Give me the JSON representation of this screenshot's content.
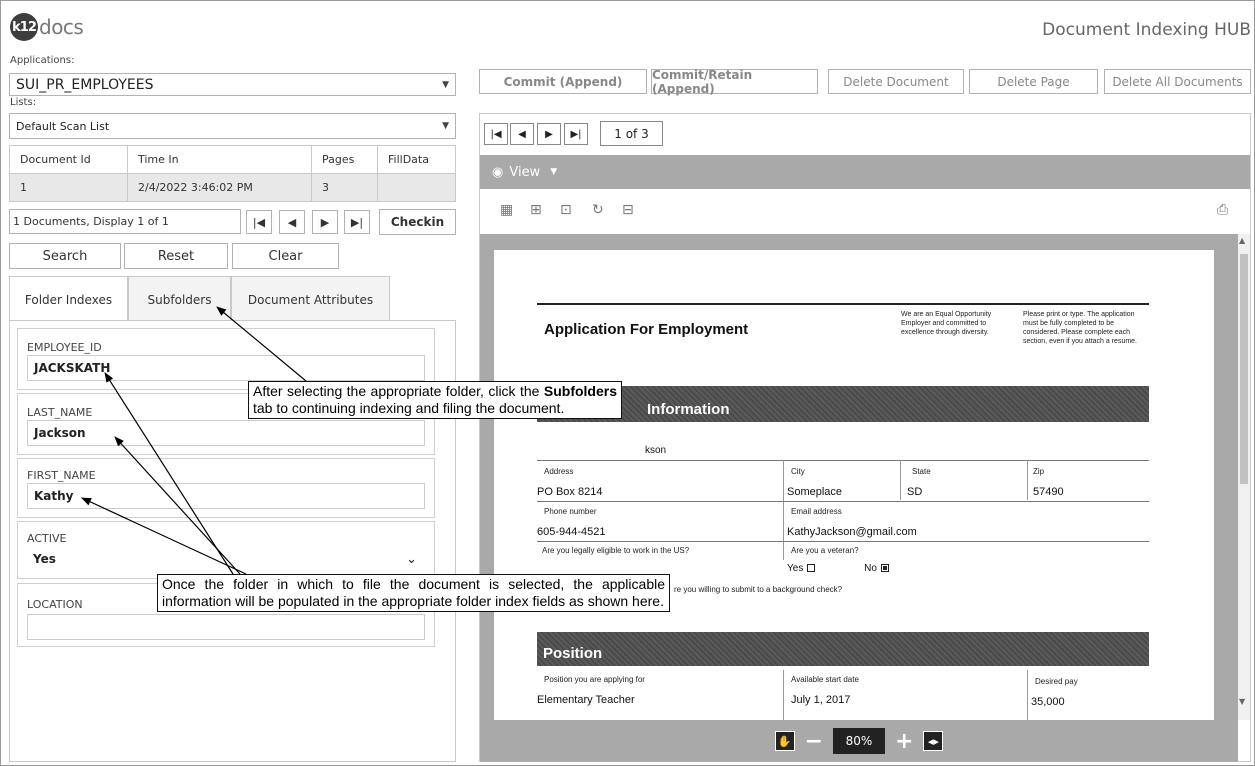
{
  "header": {
    "logo_badge": "k12",
    "logo_text": "docs",
    "app_title": "Document Indexing HUB"
  },
  "left": {
    "applications_label": "Applications:",
    "application_value": "SUI_PR_EMPLOYEES",
    "lists_label": "Lists:",
    "list_value": "Default Scan List",
    "grid": {
      "columns": [
        "Document Id",
        "Time In",
        "Pages",
        "FillData"
      ],
      "rows": [
        [
          "1",
          "2/4/2022 3:46:02 PM",
          "3",
          ""
        ]
      ]
    },
    "pager_text": "1 Documents, Display 1 of 1",
    "checkin_label": "Checkin",
    "search_label": "Search",
    "reset_label": "Reset",
    "clear_label": "Clear",
    "tabs": [
      "Folder Indexes",
      "Subfolders",
      "Document Attributes"
    ],
    "fields": [
      {
        "label": "EMPLOYEE_ID",
        "value": "JACKSKATH"
      },
      {
        "label": "LAST_NAME",
        "value": "Jackson"
      },
      {
        "label": "FIRST_NAME",
        "value": "Kathy"
      },
      {
        "label": "ACTIVE",
        "value": "Yes"
      },
      {
        "label": "LOCATION",
        "value": ""
      }
    ]
  },
  "toolbar": {
    "commit_append": "Commit (Append)",
    "commit_retain_append": "Commit/Retain (Append)",
    "delete_document": "Delete Document",
    "delete_page": "Delete Page",
    "delete_all_documents": "Delete All Documents"
  },
  "viewer": {
    "page_count": "1 of 3",
    "view_label": "View",
    "zoom": "80%"
  },
  "document": {
    "title": "Application For Employment",
    "eeo_text": "We are an Equal Opportunity Employer and committed to excellence through diversity.",
    "instructions": "Please print or type. The application must be fully completed to be considered. Please complete each section, even if you attach a resume.",
    "section_info": "Information",
    "name_partial": "kson",
    "address_label": "Address",
    "address_value": "PO Box 8214",
    "city_label": "City",
    "city_value": "Someplace",
    "state_label": "State",
    "state_value": "SD",
    "zip_label": "Zip",
    "zip_value": "57490",
    "phone_label": "Phone number",
    "phone_value": "605-944-4521",
    "email_label": "Email address",
    "email_value": "KathyJackson@gmail.com",
    "eligible_q": "Are you legally eligible to work in the US?",
    "yes_label": "Yes",
    "no_label": "No",
    "veteran_q": "Are you a veteran?",
    "background_q": "re you willing to submit to a background check?",
    "section_position": "Position",
    "position_label": "Position you are applying for",
    "position_value": "Elementary Teacher",
    "start_label": "Available start date",
    "start_value": "July 1, 2017",
    "pay_label": "Desired pay",
    "pay_value": "35,000"
  },
  "callouts": {
    "subfolders_pre": "After selecting the appropriate folder, click the ",
    "subfolders_bold": "Subfolders",
    "subfolders_post": " tab to continuing indexing and filing the document.",
    "populated": "Once the folder in which to file the document is selected, the applicable information will be populated in the appropriate folder index fields as shown here."
  }
}
